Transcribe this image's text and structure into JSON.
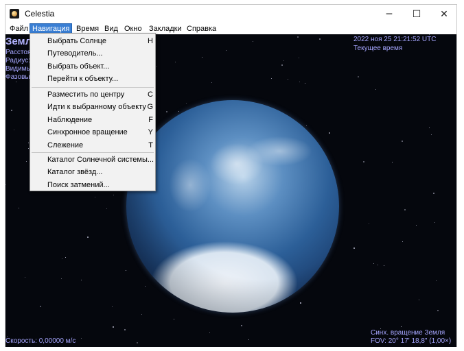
{
  "window": {
    "title": "Celestia",
    "controls": {
      "minimize": "─",
      "maximize": "☐",
      "close": "✕"
    }
  },
  "menubar": {
    "items": [
      {
        "label": "Файл",
        "active": false
      },
      {
        "label": "Навигация",
        "active": true
      },
      {
        "label": "Время",
        "active": false
      },
      {
        "label": "Вид",
        "active": false
      },
      {
        "label": "Окно",
        "active": false
      },
      {
        "label": "Закладки",
        "active": false
      },
      {
        "label": "Справка",
        "active": false
      }
    ]
  },
  "dropdown": {
    "items": [
      {
        "label": "Выбрать Солнце",
        "shortcut": "H"
      },
      {
        "label": "Путеводитель...",
        "shortcut": ""
      },
      {
        "label": "Выбрать объект...",
        "shortcut": ""
      },
      {
        "label": "Перейти к объекту...",
        "shortcut": ""
      },
      {
        "label": "Разместить по центру",
        "shortcut": "C"
      },
      {
        "label": "Идти к выбранному объекту",
        "shortcut": "G"
      },
      {
        "label": "Наблюдение",
        "shortcut": "F"
      },
      {
        "label": "Синхронное вращение",
        "shortcut": "Y"
      },
      {
        "label": "Слежение",
        "shortcut": "T"
      },
      {
        "label": "Каталог Солнечной системы...",
        "shortcut": ""
      },
      {
        "label": "Каталог звёзд...",
        "shortcut": ""
      },
      {
        "label": "Поиск затмений...",
        "shortcut": ""
      }
    ]
  },
  "hud": {
    "object_name": "Земля",
    "info_lines": [
      "Расстоя",
      "Радиус:",
      "Видимы",
      "Фазовы"
    ],
    "datetime": "2022 ноя 25 21:21:52 UTC",
    "time_mode": "Текущее время",
    "speed": "Скорость: 0,00000 м/с",
    "nav_mode": "Синх. вращение Земля",
    "fov": "FOV: 20° 17' 18,8\" (1,00×)"
  },
  "colors": {
    "hud_text": "#a6a6ff",
    "menu_highlight": "#3a7fd4",
    "space_background": "#05070d"
  },
  "icons": {
    "app": "celestia-app-icon",
    "minimize": "minimize-icon",
    "maximize": "maximize-icon",
    "close": "close-icon"
  }
}
